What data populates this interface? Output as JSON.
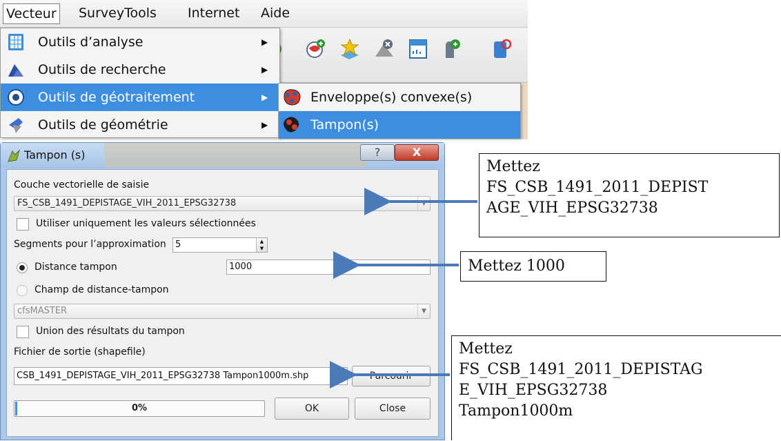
{
  "menubar": {
    "items": [
      "Vecteur",
      "SurveyTools",
      "Internet",
      "Aide"
    ]
  },
  "vector_menu": {
    "items": [
      {
        "label": "Outils d’analyse",
        "icon": "analysis-tools-icon"
      },
      {
        "label": "Outils de recherche",
        "icon": "research-tools-icon"
      },
      {
        "label": "Outils de géotraitement",
        "icon": "geoprocessing-tools-icon",
        "highlighted": true
      },
      {
        "label": "Outils de géométrie",
        "icon": "geometry-tools-icon"
      }
    ],
    "submenu": [
      {
        "label": "Enveloppe(s) convexe(s)",
        "icon": "convex-hull-icon"
      },
      {
        "label": "Tampon(s)",
        "icon": "buffer-icon",
        "highlighted": true
      }
    ]
  },
  "dialog": {
    "title": "Tampon (s)",
    "help_label": "?",
    "close_label": "X",
    "input_layer_label": "Couche vectorielle de saisie",
    "input_layer_value": "FS_CSB_1491_DEPISTAGE_VIH_2011_EPSG32738",
    "selected_only_label": "Utiliser uniquement les valeurs sélectionnées",
    "segments_label": "Segments pour l’approximation",
    "segments_value": "5",
    "buffer_distance_label": "Distance tampon",
    "buffer_distance_value": "1000",
    "buffer_field_label": "Champ de distance-tampon",
    "buffer_field_value": "cfsMASTER",
    "dissolve_label": "Union des résultats du tampon",
    "output_label": "Fichier de sortie (shapefile)",
    "output_value": "CSB_1491_DEPISTAGE_VIH_2011_EPSG32738 Tampon1000m.shp",
    "browse_label": "Parcourir",
    "progress_text": "0%",
    "progress": 0,
    "ok_label": "OK",
    "close_button_label": "Close"
  },
  "callouts": {
    "layer": [
      "Mettez",
      "FS_CSB_1491_2011_DEPIST",
      "AGE_VIH_EPSG32738"
    ],
    "distance": [
      "Mettez 1000"
    ],
    "output": [
      "Mettez",
      "FS_CSB_1491_2011_DEPISTAG",
      "E_VIH_EPSG32738",
      "Tampon1000m"
    ]
  },
  "colors": {
    "highlight": "#3d8ee0",
    "arrow": "#4a7ab8",
    "dialog_frame": "#a9c8ea",
    "close_red": "#c13a28"
  }
}
